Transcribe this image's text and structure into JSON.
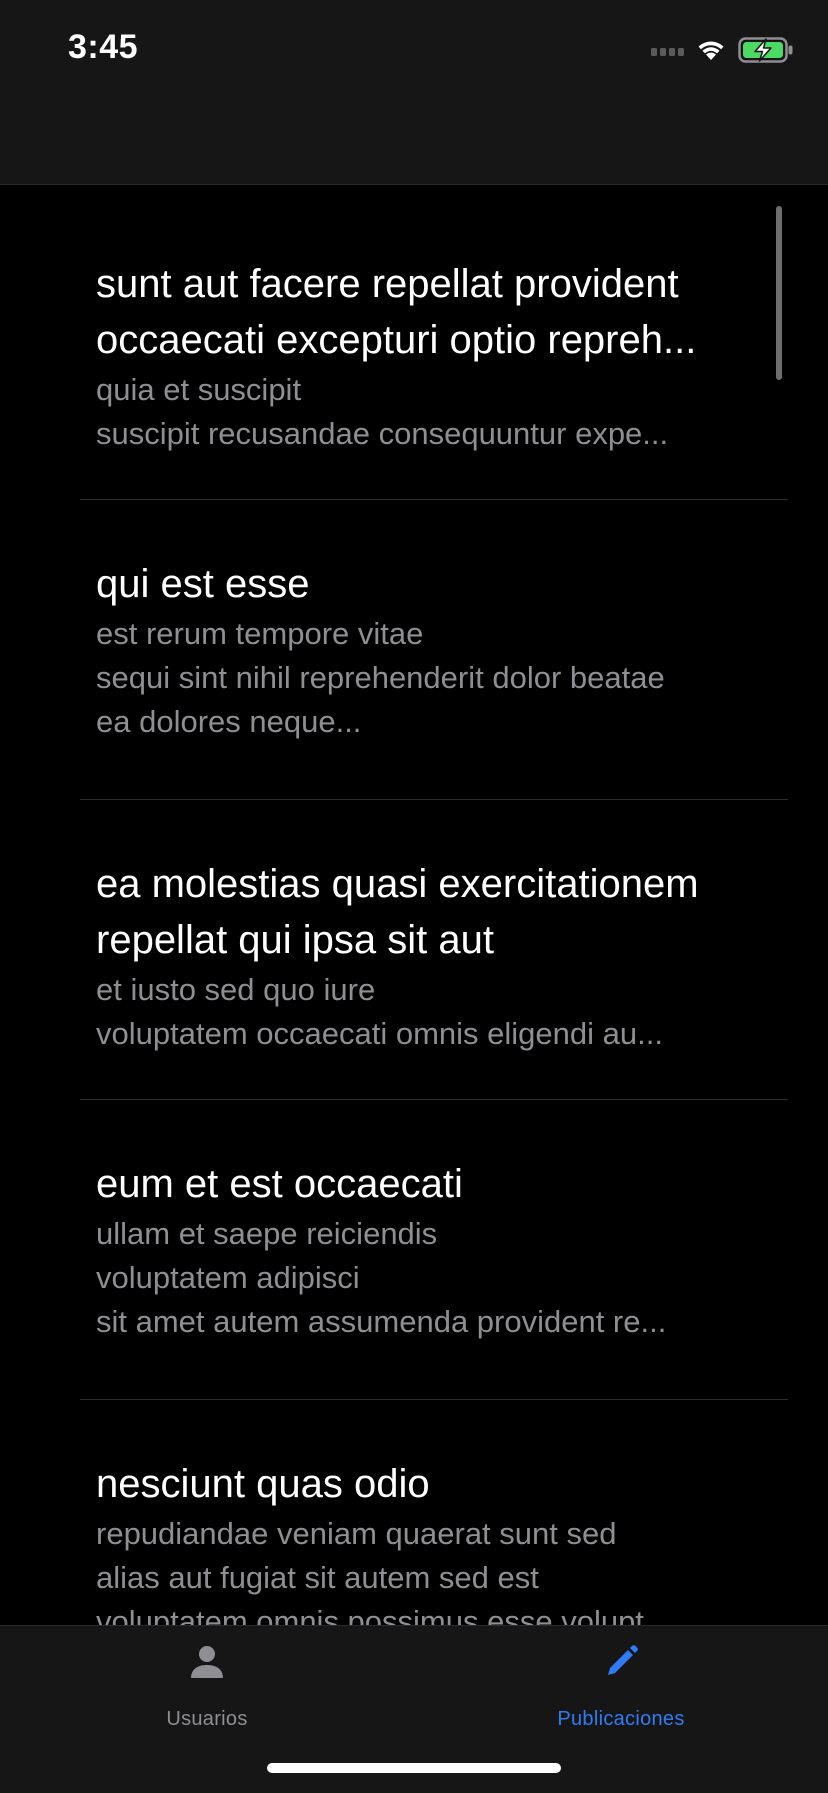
{
  "status_bar": {
    "time": "3:45",
    "icons": [
      "cellular-signal-icon",
      "wifi-icon",
      "battery-charging-icon"
    ],
    "battery_color": "#4cd964"
  },
  "posts": [
    {
      "title_lines": [
        "sunt aut facere repellat provident",
        "occaecati excepturi optio repreh..."
      ],
      "body_lines": [
        "quia et suscipit",
        "suscipit recusandae consequuntur expe..."
      ]
    },
    {
      "title_lines": [
        "qui est esse"
      ],
      "body_lines": [
        "est rerum tempore vitae",
        "sequi sint nihil reprehenderit dolor beatae",
        "ea dolores neque..."
      ]
    },
    {
      "title_lines": [
        "ea molestias quasi exercitationem",
        "repellat qui ipsa sit aut"
      ],
      "body_lines": [
        "et iusto sed quo iure",
        "voluptatem occaecati omnis eligendi au..."
      ]
    },
    {
      "title_lines": [
        "eum et est occaecati"
      ],
      "body_lines": [
        "ullam et saepe reiciendis",
        "voluptatem adipisci",
        "sit amet autem assumenda provident re..."
      ]
    },
    {
      "title_lines": [
        "nesciunt quas odio"
      ],
      "body_lines": [
        "repudiandae veniam quaerat sunt sed",
        "alias aut fugiat sit autem sed est",
        "voluptatem omnis possimus esse volupt..."
      ]
    }
  ],
  "tab_bar": {
    "tabs": [
      {
        "label": "Usuarios",
        "icon": "person-icon",
        "selected": false
      },
      {
        "label": "Publicaciones",
        "icon": "pencil-icon",
        "selected": true
      }
    ],
    "inactive_color": "#8e8e93",
    "active_color": "#2f7cf6"
  }
}
